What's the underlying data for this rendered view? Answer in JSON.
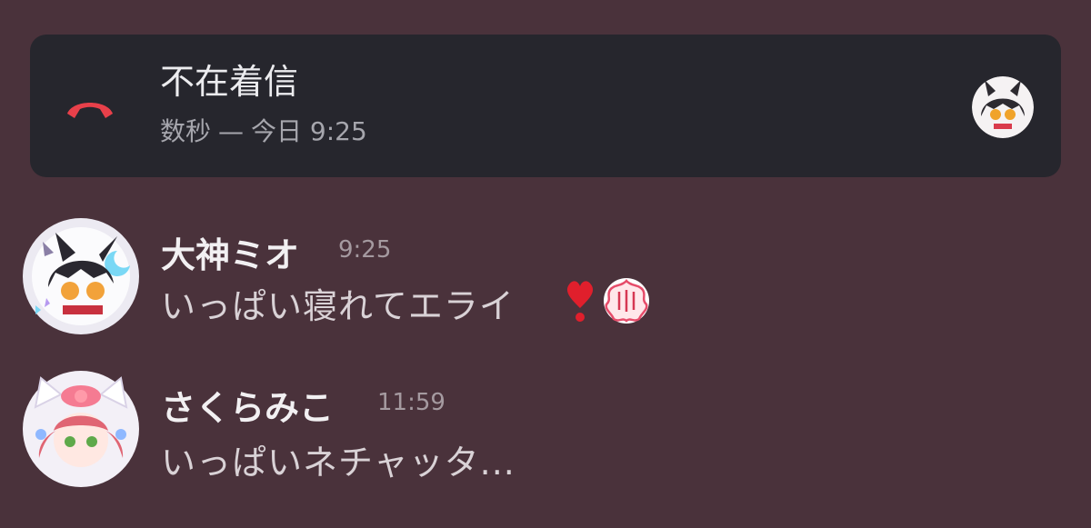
{
  "call": {
    "title": "不在着信",
    "duration": "数秒",
    "separator": "—",
    "time": "今日 9:25",
    "icon": "phone-hangup-icon",
    "icon_color": "#e8404a"
  },
  "messages": [
    {
      "author": "大神ミオ",
      "time": "9:25",
      "text": "いっぱい寝れてエライ",
      "emoji": "heavy-red-exclamation-icon",
      "sticker": "sakura-stamp-icon"
    },
    {
      "author": "さくらみこ",
      "time": "11:59",
      "text": "いっぱいネチャッタ..."
    }
  ],
  "colors": {
    "background": "#4a323b",
    "card": "#26262d",
    "author": "#f2f0f2",
    "timestamp": "#a59aa0",
    "body_text": "#d9d2d6"
  }
}
